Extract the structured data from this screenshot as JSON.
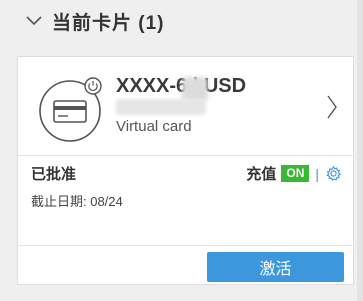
{
  "section": {
    "title": "当前卡片 (1)",
    "collapse_icon": "chevron-down-icon"
  },
  "card": {
    "number": "XXXX-6    | USD",
    "type": "Virtual card",
    "icon": "credit-card-power-icon",
    "status": "已批准",
    "expiry": "截止日期: 08/24",
    "recharge_label": "充值",
    "recharge_toggle": "ON",
    "recharge_separator": "|",
    "settings_icon": "gear-icon",
    "activate_label": "激活"
  },
  "colors": {
    "accent": "#3d97dc",
    "toggle_on": "#38b833",
    "background": "#efefef"
  }
}
